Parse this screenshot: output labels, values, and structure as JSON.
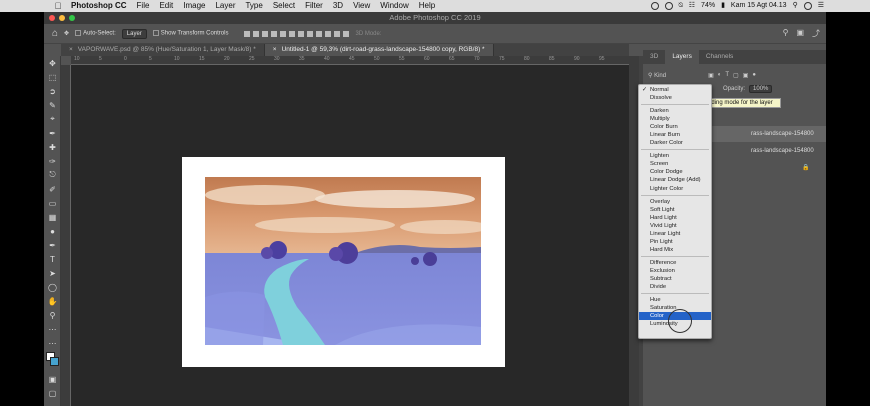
{
  "mac_menubar": {
    "app": "Photoshop CC",
    "items": [
      "File",
      "Edit",
      "Image",
      "Layer",
      "Type",
      "Select",
      "Filter",
      "3D",
      "View",
      "Window",
      "Help"
    ],
    "battery": "74%",
    "datetime": "Kam 15 Agt 04.13"
  },
  "window": {
    "title": "Adobe Photoshop CC 2019"
  },
  "options_bar": {
    "auto_select_label": "Auto-Select:",
    "layer_dropdown": "Layer",
    "transform_label": "Show Transform Controls",
    "mode_3d": "3D Mode:"
  },
  "doc_tabs": [
    {
      "label": "VAPORWAVE.psd @ 85% (Hue/Saturation 1, Layer Mask/8) *"
    },
    {
      "label": "Untitled-1 @ 59,3% (dirt-road-grass-landscape-154800 copy, RGB/8) *"
    }
  ],
  "ruler_marks": [
    "10",
    "5",
    "0",
    "5",
    "10",
    "15",
    "20",
    "25",
    "30",
    "35",
    "40",
    "45",
    "50",
    "55",
    "60",
    "65",
    "70",
    "75",
    "80",
    "85",
    "90",
    "95"
  ],
  "panel": {
    "tabs": [
      "3D",
      "Layers",
      "Channels"
    ],
    "kind": "Kind",
    "opacity_label": "Opacity:",
    "opacity_value": "100%",
    "layers": [
      {
        "name": "rass-landscape-154800 copy"
      },
      {
        "name": "rass-landscape-154800"
      }
    ]
  },
  "tooltip": "nding mode for the layer",
  "blend_menu": {
    "groups": [
      [
        "Normal",
        "Dissolve"
      ],
      [
        "Darken",
        "Multiply",
        "Color Burn",
        "Linear Burn",
        "Darker Color"
      ],
      [
        "Lighten",
        "Screen",
        "Color Dodge",
        "Linear Dodge (Add)",
        "Lighter Color"
      ],
      [
        "Overlay",
        "Soft Light",
        "Hard Light",
        "Vivid Light",
        "Linear Light",
        "Pin Light",
        "Hard Mix"
      ],
      [
        "Difference",
        "Exclusion",
        "Subtract",
        "Divide"
      ],
      [
        "Hue",
        "Saturation",
        "Color",
        "Luminosity"
      ]
    ],
    "checked": "Normal",
    "selected": "Color"
  },
  "colors": {
    "accent": "#2463c8",
    "sky": "#c8845a",
    "grass": "#7a86d8",
    "road": "#7fd0dc"
  }
}
